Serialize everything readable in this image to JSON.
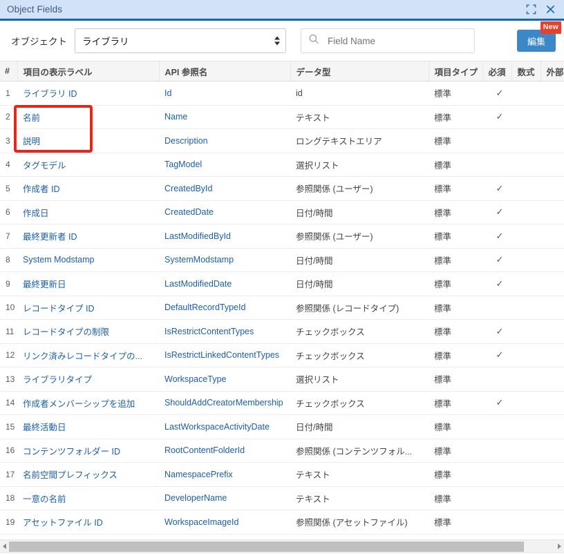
{
  "window": {
    "title": "Object Fields",
    "expand_icon": "expand-icon",
    "close_icon": "close-icon"
  },
  "toolbar": {
    "object_label": "オブジェクト",
    "object_selected": "ライブラリ",
    "search_placeholder": "Field Name",
    "search_value": "",
    "search_icon": "search-icon",
    "edit_label": "編集",
    "new_badge": "New",
    "accent_color": "#1565c0",
    "edit_button_color": "#3b87c8",
    "badge_color": "#e8402a",
    "annotation_color": "#e8241b"
  },
  "table": {
    "columns": [
      "#",
      "項目の表示ラベル",
      "API 参照名",
      "データ型",
      "項目タイプ",
      "必須",
      "数式",
      "外部"
    ],
    "rows": [
      {
        "num": "1",
        "label": "ライブラリ ID",
        "api": "Id",
        "type": "id",
        "ftype": "標準",
        "required": "✓",
        "formula": "",
        "external": ""
      },
      {
        "num": "2",
        "label": "名前",
        "api": "Name",
        "type": "テキスト",
        "ftype": "標準",
        "required": "✓",
        "formula": "",
        "external": ""
      },
      {
        "num": "3",
        "label": "説明",
        "api": "Description",
        "type": "ロングテキストエリア",
        "ftype": "標準",
        "required": "",
        "formula": "",
        "external": ""
      },
      {
        "num": "4",
        "label": "タグモデル",
        "api": "TagModel",
        "type": "選択リスト",
        "ftype": "標準",
        "required": "",
        "formula": "",
        "external": ""
      },
      {
        "num": "5",
        "label": "作成者 ID",
        "api": "CreatedById",
        "type": "参照関係 (ユーザー)",
        "ftype": "標準",
        "required": "✓",
        "formula": "",
        "external": ""
      },
      {
        "num": "6",
        "label": "作成日",
        "api": "CreatedDate",
        "type": "日付/時間",
        "ftype": "標準",
        "required": "✓",
        "formula": "",
        "external": ""
      },
      {
        "num": "7",
        "label": "最終更新者 ID",
        "api": "LastModifiedById",
        "type": "参照関係 (ユーザー)",
        "ftype": "標準",
        "required": "✓",
        "formula": "",
        "external": ""
      },
      {
        "num": "8",
        "label": "System Modstamp",
        "api": "SystemModstamp",
        "type": "日付/時間",
        "ftype": "標準",
        "required": "✓",
        "formula": "",
        "external": ""
      },
      {
        "num": "9",
        "label": "最終更新日",
        "api": "LastModifiedDate",
        "type": "日付/時間",
        "ftype": "標準",
        "required": "✓",
        "formula": "",
        "external": ""
      },
      {
        "num": "10",
        "label": "レコードタイプ ID",
        "api": "DefaultRecordTypeId",
        "type": "参照関係 (レコードタイプ)",
        "ftype": "標準",
        "required": "",
        "formula": "",
        "external": ""
      },
      {
        "num": "11",
        "label": "レコードタイプの制限",
        "api": "IsRestrictContentTypes",
        "type": "チェックボックス",
        "ftype": "標準",
        "required": "✓",
        "formula": "",
        "external": ""
      },
      {
        "num": "12",
        "label": "リンク済みレコードタイプの...",
        "api": "IsRestrictLinkedContentTypes",
        "type": "チェックボックス",
        "ftype": "標準",
        "required": "✓",
        "formula": "",
        "external": ""
      },
      {
        "num": "13",
        "label": "ライブラリタイプ",
        "api": "WorkspaceType",
        "type": "選択リスト",
        "ftype": "標準",
        "required": "",
        "formula": "",
        "external": ""
      },
      {
        "num": "14",
        "label": "作成者メンバーシップを追加",
        "api": "ShouldAddCreatorMembership",
        "type": "チェックボックス",
        "ftype": "標準",
        "required": "✓",
        "formula": "",
        "external": ""
      },
      {
        "num": "15",
        "label": "最終活動日",
        "api": "LastWorkspaceActivityDate",
        "type": "日付/時間",
        "ftype": "標準",
        "required": "",
        "formula": "",
        "external": ""
      },
      {
        "num": "16",
        "label": "コンテンツフォルダー ID",
        "api": "RootContentFolderId",
        "type": "参照関係 (コンテンツフォル...",
        "ftype": "標準",
        "required": "",
        "formula": "",
        "external": ""
      },
      {
        "num": "17",
        "label": "名前空間プレフィックス",
        "api": "NamespacePrefix",
        "type": "テキスト",
        "ftype": "標準",
        "required": "",
        "formula": "",
        "external": ""
      },
      {
        "num": "18",
        "label": "一意の名前",
        "api": "DeveloperName",
        "type": "テキスト",
        "ftype": "標準",
        "required": "",
        "formula": "",
        "external": ""
      },
      {
        "num": "19",
        "label": "アセットファイル ID",
        "api": "WorkspaceImageId",
        "type": "参照関係 (アセットファイル)",
        "ftype": "標準",
        "required": "",
        "formula": "",
        "external": ""
      }
    ]
  }
}
